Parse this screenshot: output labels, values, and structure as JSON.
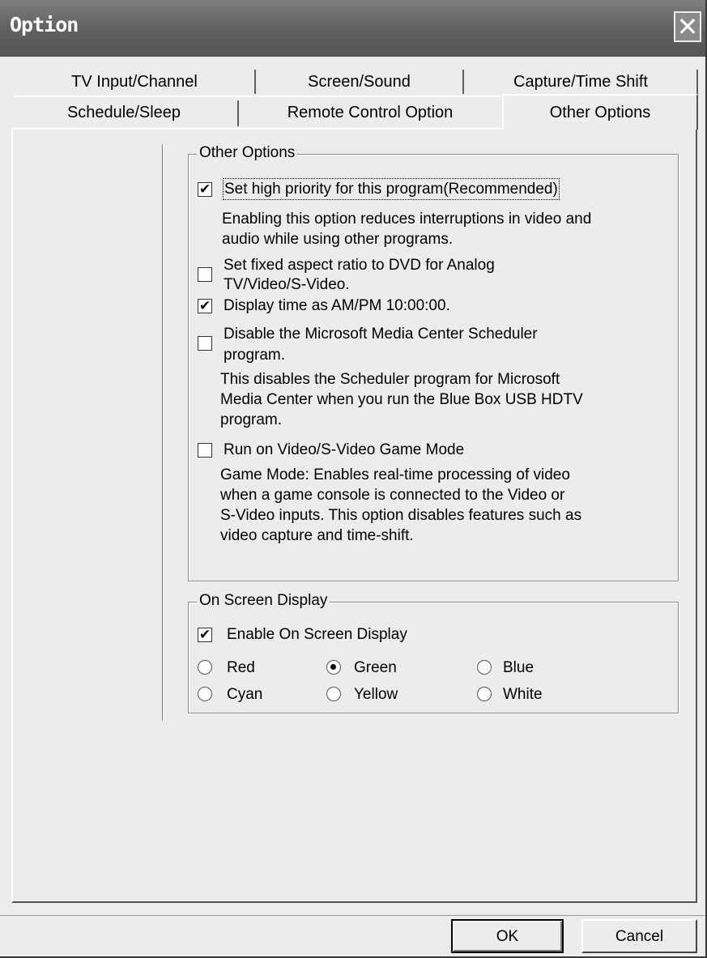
{
  "window": {
    "title": "Option",
    "close_symbol": "✕"
  },
  "tabs": {
    "row1": [
      "TV Input/Channel",
      "Screen/Sound",
      "Capture/Time Shift"
    ],
    "row2": [
      "Schedule/Sleep",
      "Remote Control Option",
      "Other Options"
    ],
    "active": "Other Options"
  },
  "other_options": {
    "group_title": "Other Options",
    "high_priority": {
      "checked": true,
      "label": "Set high priority for this program(Recommended)",
      "desc": [
        "Enabling this option reduces interruptions in video and",
        "audio while using other programs."
      ]
    },
    "fixed_aspect": {
      "checked": false,
      "label": [
        "Set fixed aspect ratio to DVD for Analog",
        "TV/Video/S-Video."
      ]
    },
    "ampm": {
      "checked": true,
      "label": "Display time as AM/PM 10:00:00."
    },
    "disable_scheduler": {
      "checked": false,
      "label": [
        "Disable the Microsoft Media Center Scheduler",
        "program."
      ],
      "desc": [
        "This disables the Scheduler program for Microsoft",
        "Media Center when you run the Blue Box USB HDTV",
        "program."
      ]
    },
    "game_mode": {
      "checked": false,
      "label": "Run on Video/S-Video Game Mode",
      "desc": [
        "Game Mode:  Enables real-time processing of video",
        "when a game console is connected to the Video or",
        "S-Video inputs.  This option disables features such as",
        "video capture and time-shift."
      ]
    }
  },
  "osd": {
    "group_title": "On Screen Display",
    "enable": {
      "checked": true,
      "label": "Enable On Screen Display"
    },
    "colors": [
      "Red",
      "Green",
      "Blue",
      "Cyan",
      "Yellow",
      "White"
    ],
    "selected_color": "Green"
  },
  "buttons": {
    "ok": "OK",
    "cancel": "Cancel"
  },
  "check_mark": "✔"
}
